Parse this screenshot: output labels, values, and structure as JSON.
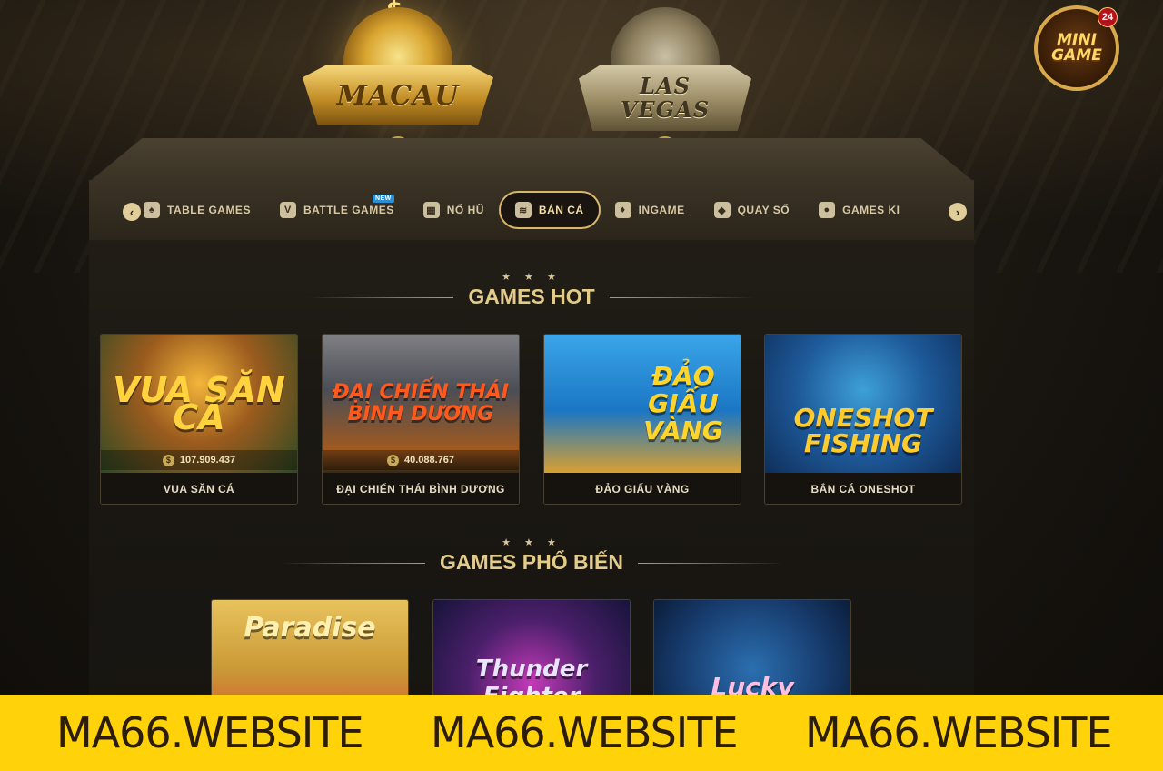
{
  "regions": [
    {
      "label": "MACAU",
      "selected": true
    },
    {
      "label": "LAS VEGAS",
      "selected": false
    }
  ],
  "mini_game": {
    "label": "MINI GAME",
    "badge": "24"
  },
  "tabs": [
    {
      "label": "TABLE GAMES",
      "icon": "cards-icon",
      "active": false
    },
    {
      "label": "BATTLE GAMES",
      "icon": "vs-shield-icon",
      "active": false,
      "badge": "NEW"
    },
    {
      "label": "NỔ HŨ",
      "icon": "slot-icon",
      "active": false
    },
    {
      "label": "BẮN CÁ",
      "icon": "fish-icon",
      "active": true
    },
    {
      "label": "INGAME",
      "icon": "ingame-cards-icon",
      "active": false
    },
    {
      "label": "QUAY SỐ",
      "icon": "lottery-icon",
      "active": false
    },
    {
      "label": "GAMES KI",
      "icon": "games-ki-icon",
      "active": false
    }
  ],
  "hot_section": {
    "title": "GAMES HOT",
    "stars": "★ ★ ★",
    "games": [
      {
        "name": "VUA SĂN CÁ",
        "art_text": "VUA SĂN CÁ",
        "jackpot": "107.909.437"
      },
      {
        "name": "ĐẠI CHIẾN THÁI BÌNH DƯƠNG",
        "art_text": "ĐẠI CHIẾN THÁI BÌNH DƯƠNG",
        "jackpot": "40.088.767"
      },
      {
        "name": "ĐẢO GIẤU VÀNG",
        "art_text": "ĐẢO GIẤU VÀNG",
        "jackpot": ""
      },
      {
        "name": "BẮN CÁ ONESHOT",
        "art_text": "ONESHOT FISHING",
        "jackpot": ""
      }
    ]
  },
  "popular_section": {
    "title": "GAMES PHỔ BIẾN",
    "stars": "★ ★ ★",
    "games": [
      {
        "art_text": "Paradise"
      },
      {
        "art_text": "Thunder Fighter"
      },
      {
        "art_text": "Lucky"
      }
    ]
  },
  "watermark": [
    "MA66.WEBSITE",
    "MA66.WEBSITE",
    "MA66.WEBSITE"
  ]
}
